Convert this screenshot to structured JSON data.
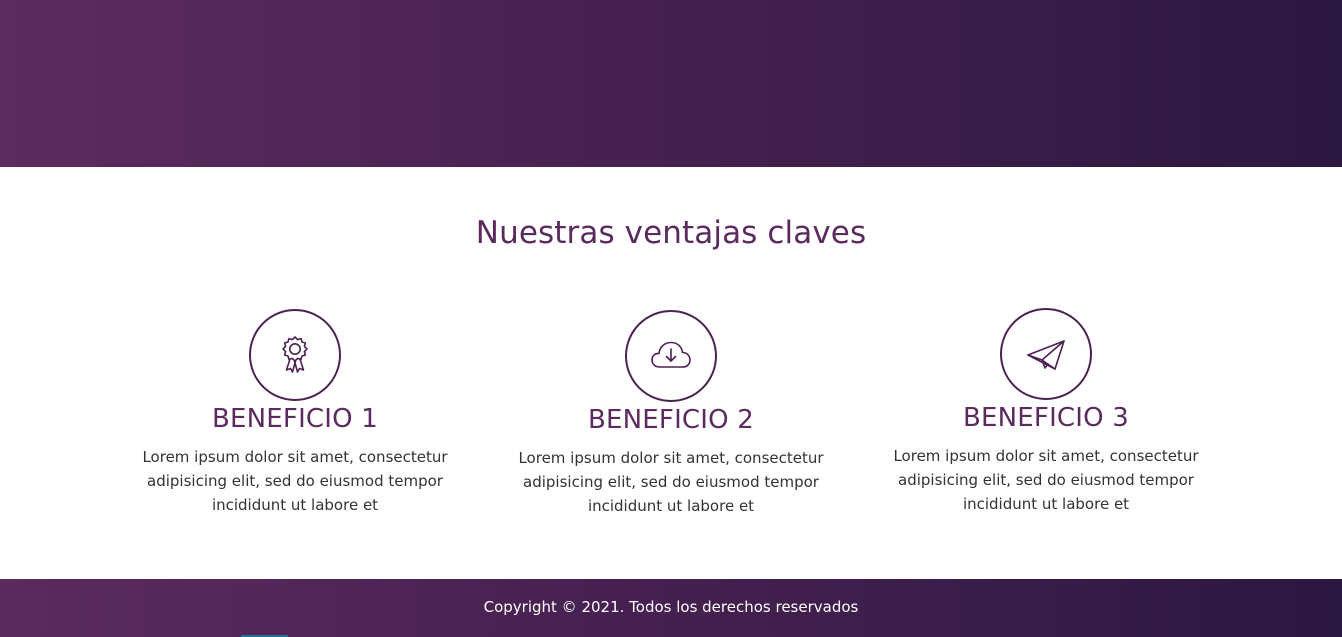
{
  "benefits_section": {
    "title": "Nuestras ventajas claves",
    "items": [
      {
        "icon": "award-ribbon-icon",
        "title": "BENEFICIO 1",
        "text": "Lorem ipsum dolor sit amet, consectetur adipisicing elit, sed do eiusmod tempor incididunt ut labore et"
      },
      {
        "icon": "cloud-download-icon",
        "title": "BENEFICIO 2",
        "text": "Lorem ipsum dolor sit amet, consectetur adipisicing elit, sed do eiusmod tempor incididunt ut labore et"
      },
      {
        "icon": "paper-plane-icon",
        "title": "BENEFICIO 3",
        "text": "Lorem ipsum dolor sit amet, consectetur adipisicing elit, sed do eiusmod tempor incididunt ut labore et"
      }
    ]
  },
  "footer": {
    "copyright": "Copyright © 2021. Todos los derechos reservados"
  },
  "colors": {
    "brand_purple": "#5b2b5f",
    "gradient_dark": "#2b1841",
    "text_body": "#333333"
  }
}
